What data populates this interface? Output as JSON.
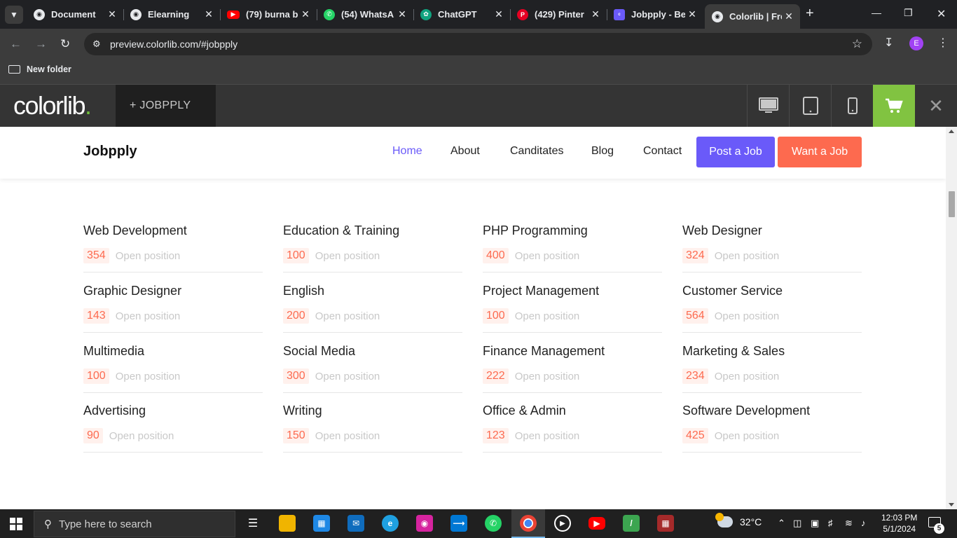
{
  "browser": {
    "tabs": [
      {
        "label": "Document",
        "icon": "globe-icon"
      },
      {
        "label": "Elearning",
        "icon": "globe-icon"
      },
      {
        "label": "(79) burna b",
        "icon": "youtube-icon"
      },
      {
        "label": "(54) WhatsA",
        "icon": "whatsapp-icon"
      },
      {
        "label": "ChatGPT",
        "icon": "chatgpt-icon"
      },
      {
        "label": "(429) Pinter",
        "icon": "pinterest-icon"
      },
      {
        "label": "Jobpply - Be",
        "icon": "colorlib-icon"
      },
      {
        "label": "Colorlib | Fre",
        "icon": "globe-icon",
        "active": true
      }
    ],
    "url": "preview.colorlib.com/#jobpply",
    "bookmark_folder": "New folder",
    "profile_initial": "E"
  },
  "colorlib_bar": {
    "logo_text": "colorlib",
    "logo_dot": ".",
    "theme_label": "+  JOBPPLY",
    "cart_color": "#81c341"
  },
  "site": {
    "brand": "Jobpply",
    "nav": [
      {
        "label": "Home",
        "active": true
      },
      {
        "label": "About"
      },
      {
        "label": "Canditates"
      },
      {
        "label": "Blog"
      },
      {
        "label": "Contact"
      }
    ],
    "post_job": "Post a Job",
    "want_job": "Want a Job",
    "accent": "#6a5af9",
    "secondary": "#fd6a4f"
  },
  "categories": [
    {
      "name": "Web Development",
      "count": "354",
      "label": "Open position"
    },
    {
      "name": "Education & Training",
      "count": "100",
      "label": "Open position"
    },
    {
      "name": "PHP Programming",
      "count": "400",
      "label": "Open position"
    },
    {
      "name": "Web Designer",
      "count": "324",
      "label": "Open position"
    },
    {
      "name": "Graphic Designer",
      "count": "143",
      "label": "Open position"
    },
    {
      "name": "English",
      "count": "200",
      "label": "Open position"
    },
    {
      "name": "Project Management",
      "count": "100",
      "label": "Open position"
    },
    {
      "name": "Customer Service",
      "count": "564",
      "label": "Open position"
    },
    {
      "name": "Multimedia",
      "count": "100",
      "label": "Open position"
    },
    {
      "name": "Social Media",
      "count": "300",
      "label": "Open position"
    },
    {
      "name": "Finance Management",
      "count": "222",
      "label": "Open position"
    },
    {
      "name": "Marketing & Sales",
      "count": "234",
      "label": "Open position"
    },
    {
      "name": "Advertising",
      "count": "90",
      "label": "Open position"
    },
    {
      "name": "Writing",
      "count": "150",
      "label": "Open position"
    },
    {
      "name": "Office & Admin",
      "count": "123",
      "label": "Open position"
    },
    {
      "name": "Software Development",
      "count": "425",
      "label": "Open position"
    }
  ],
  "taskbar": {
    "search_placeholder": "Type here to search",
    "weather": "32°C",
    "time": "12:03 PM",
    "date": "5/1/2024",
    "notifications": "5"
  }
}
